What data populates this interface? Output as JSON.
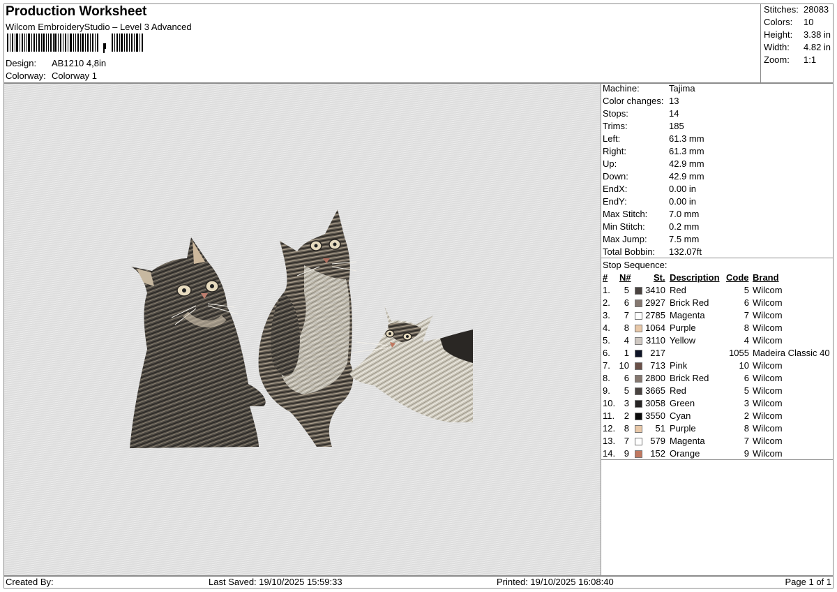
{
  "header": {
    "title": "Production Worksheet",
    "subtitle": "Wilcom EmbroideryStudio – Level 3 Advanced",
    "design_label": "Design:",
    "design_value": "AB1210 4,8in",
    "colorway_label": "Colorway:",
    "colorway_value": "Colorway 1"
  },
  "summary": [
    {
      "k": "Stitches:",
      "v": "28083"
    },
    {
      "k": "Colors:",
      "v": "10"
    },
    {
      "k": "Height:",
      "v": "3.38 in"
    },
    {
      "k": "Width:",
      "v": "4.82 in"
    },
    {
      "k": "Zoom:",
      "v": "1:1"
    }
  ],
  "machine": [
    {
      "k": "Machine:",
      "v": "Tajima"
    },
    {
      "k": "Color changes:",
      "v": "13"
    },
    {
      "k": "Stops:",
      "v": "14"
    },
    {
      "k": "Trims:",
      "v": "185"
    },
    {
      "k": "Left:",
      "v": "61.3 mm"
    },
    {
      "k": "Right:",
      "v": "61.3 mm"
    },
    {
      "k": "Up:",
      "v": "42.9 mm"
    },
    {
      "k": "Down:",
      "v": "42.9 mm"
    },
    {
      "k": "EndX:",
      "v": "0.00 in"
    },
    {
      "k": "EndY:",
      "v": "0.00 in"
    },
    {
      "k": "Max Stitch:",
      "v": "7.0 mm"
    },
    {
      "k": "Min Stitch:",
      "v": "0.2 mm"
    },
    {
      "k": "Max Jump:",
      "v": "7.5 mm"
    },
    {
      "k": "Total Bobbin:",
      "v": "132.07ft"
    }
  ],
  "stop_sequence": {
    "label": "Stop Sequence:",
    "headers": {
      "idx": "#",
      "n": "N#",
      "st": "St.",
      "desc": "Description",
      "code": "Code",
      "brand": "Brand"
    },
    "rows": [
      {
        "idx": "1.",
        "n": "5",
        "color": "#4a4340",
        "st": "3410",
        "desc": "Red",
        "code": "5",
        "brand": "Wilcom"
      },
      {
        "idx": "2.",
        "n": "6",
        "color": "#857870",
        "st": "2927",
        "desc": "Brick Red",
        "code": "6",
        "brand": "Wilcom"
      },
      {
        "idx": "3.",
        "n": "7",
        "color": "#ffffff",
        "st": "2785",
        "desc": "Magenta",
        "code": "7",
        "brand": "Wilcom"
      },
      {
        "idx": "4.",
        "n": "8",
        "color": "#e8c8a8",
        "st": "1064",
        "desc": "Purple",
        "code": "8",
        "brand": "Wilcom"
      },
      {
        "idx": "5.",
        "n": "4",
        "color": "#cfc8c2",
        "st": "3110",
        "desc": "Yellow",
        "code": "4",
        "brand": "Wilcom"
      },
      {
        "idx": "6.",
        "n": "1",
        "color": "#0e1426",
        "st": "217",
        "desc": "",
        "code": "1055",
        "brand": "Madeira Classic 40"
      },
      {
        "idx": "7.",
        "n": "10",
        "color": "#6a5048",
        "st": "713",
        "desc": "Pink",
        "code": "10",
        "brand": "Wilcom"
      },
      {
        "idx": "8.",
        "n": "6",
        "color": "#857870",
        "st": "2800",
        "desc": "Brick Red",
        "code": "6",
        "brand": "Wilcom"
      },
      {
        "idx": "9.",
        "n": "5",
        "color": "#4a4340",
        "st": "3665",
        "desc": "Red",
        "code": "5",
        "brand": "Wilcom"
      },
      {
        "idx": "10.",
        "n": "3",
        "color": "#262424",
        "st": "3058",
        "desc": "Green",
        "code": "3",
        "brand": "Wilcom"
      },
      {
        "idx": "11.",
        "n": "2",
        "color": "#0a0a0a",
        "st": "3550",
        "desc": "Cyan",
        "code": "2",
        "brand": "Wilcom"
      },
      {
        "idx": "12.",
        "n": "8",
        "color": "#e8c8a8",
        "st": "51",
        "desc": "Purple",
        "code": "8",
        "brand": "Wilcom"
      },
      {
        "idx": "13.",
        "n": "7",
        "color": "#ffffff",
        "st": "579",
        "desc": "Magenta",
        "code": "7",
        "brand": "Wilcom"
      },
      {
        "idx": "14.",
        "n": "9",
        "color": "#c07860",
        "st": "152",
        "desc": "Orange",
        "code": "9",
        "brand": "Wilcom"
      }
    ]
  },
  "footer": {
    "created_by": "Created By:",
    "last_saved": "Last Saved: 19/10/2025 15:59:33",
    "printed": "Printed: 19/10/2025 16:08:40",
    "page": "Page 1 of 1"
  }
}
